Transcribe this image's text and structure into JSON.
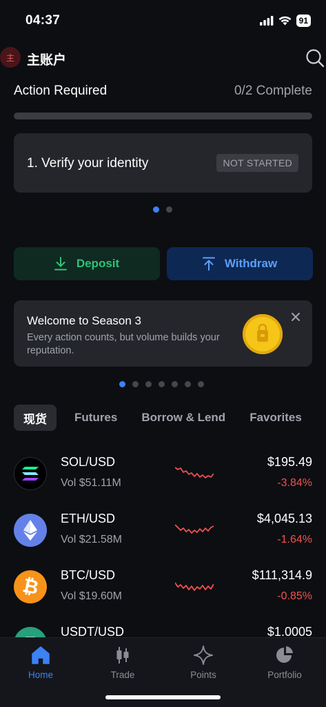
{
  "status_bar": {
    "time": "04:37",
    "battery": "91"
  },
  "account": {
    "badge": "主",
    "name": "主账户"
  },
  "action_required": {
    "title": "Action Required",
    "progress_text": "0/2 Complete",
    "progress_fraction": 0.0,
    "task_label": "1. Verify your identity",
    "task_status": "NOT STARTED"
  },
  "buttons": {
    "deposit": "Deposit",
    "withdraw": "Withdraw"
  },
  "promo": {
    "title": "Welcome to Season 3",
    "body": "Every action counts, but volume builds your reputation."
  },
  "tabs": [
    "现货",
    "Futures",
    "Borrow & Lend",
    "Favorites"
  ],
  "markets": [
    {
      "pair": "SOL/USD",
      "vol": "Vol $51.11M",
      "price": "$195.49",
      "change": "-3.84%"
    },
    {
      "pair": "ETH/USD",
      "vol": "Vol $21.58M",
      "price": "$4,045.13",
      "change": "-1.64%"
    },
    {
      "pair": "BTC/USD",
      "vol": "Vol $19.60M",
      "price": "$111,314.9",
      "change": "-0.85%"
    },
    {
      "pair": "USDT/USD",
      "vol": "",
      "price": "$1.0005",
      "change": ""
    }
  ],
  "nav": [
    "Home",
    "Trade",
    "Points",
    "Portfolio"
  ],
  "colors": {
    "accent": "#3b82f6",
    "positive": "#2fc27a",
    "negative": "#f0524f"
  }
}
